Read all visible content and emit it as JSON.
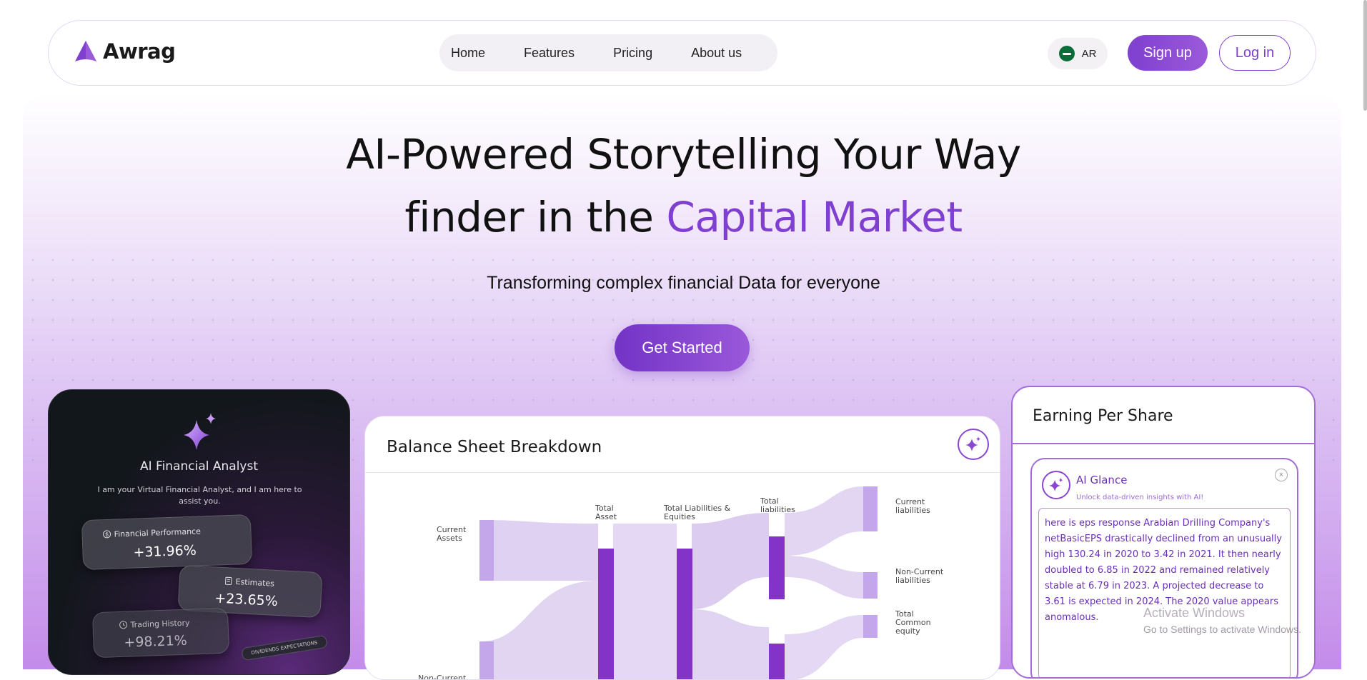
{
  "brand": {
    "name": "Awrag",
    "accent_color": "#7f3fd0"
  },
  "nav": {
    "links": [
      "Home",
      "Features",
      "Pricing",
      "About us"
    ],
    "lang_label": "AR",
    "signup_label": "Sign up",
    "login_label": "Log in"
  },
  "hero": {
    "title_line1": "AI-Powered Storytelling Your Way",
    "title_line2_plain": "finder in the ",
    "title_line2_accent": "Capital Market",
    "subtitle": "Transforming complex financial Data for everyone",
    "cta_label": "Get Started"
  },
  "analyst_card": {
    "title": "AI Financial Analyst",
    "description": "I am your Virtual Financial Analyst, and I am here to assist you.",
    "stats": [
      {
        "label": "Financial Performance",
        "value": "+31.96%",
        "icon": "dollar-icon"
      },
      {
        "label": "Estimates",
        "value": "+23.65%",
        "icon": "document-icon"
      },
      {
        "label": "Trading History",
        "value": "+98.21%",
        "icon": "history-icon"
      }
    ],
    "tag": "DIVIDENDS EXPECTATIONS"
  },
  "balance_sheet": {
    "title": "Balance Sheet Breakdown",
    "labels": {
      "current_assets": [
        "Current",
        "Assets"
      ],
      "non_current": "Non-Current",
      "total_asset": [
        "Total",
        "Asset"
      ],
      "total_liab_eq": [
        "Total Liabilities &",
        "Equities"
      ],
      "total_liabilities": [
        "Total",
        "liabilities"
      ],
      "current_liabilities": [
        "Current",
        "liabilities"
      ],
      "non_current_liabilities": [
        "Non-Current",
        "liabilities"
      ],
      "total_common_equity": [
        "Total",
        "Common",
        "equity"
      ]
    }
  },
  "eps_card": {
    "title": "Earning Per Share",
    "glance_title": "AI Glance",
    "glance_subtitle": "Unlock data-driven insights with AI!",
    "glance_text": "here is eps response Arabian Drilling Company's netBasicEPS drastically declined from an unusually high 130.24 in 2020 to 3.42 in 2021. It then nearly doubled to 6.85 in 2022 and remained relatively stable at 6.79 in 2023. A projected decrease to 3.61 is expected in 2024. The 2020 value appears anomalous."
  },
  "watermark": {
    "line1": "Activate Windows",
    "line2": "Go to Settings to activate Windows."
  }
}
